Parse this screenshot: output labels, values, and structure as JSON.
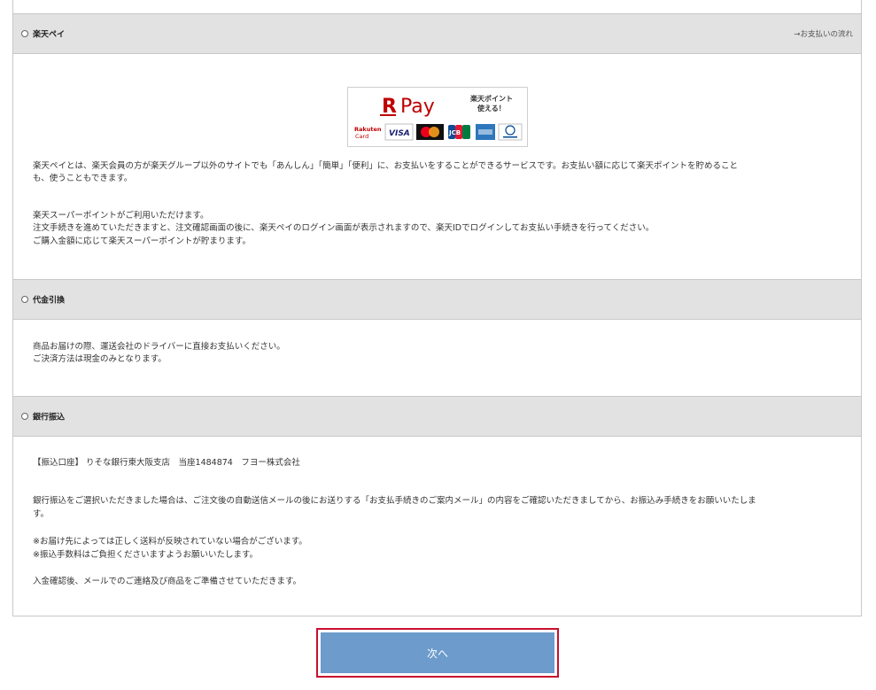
{
  "rakuten_pay": {
    "label": "楽天ペイ",
    "flow_link": "→お支払いの流れ",
    "logo": {
      "brand": "Pay",
      "tagline_line1": "楽天ポイント",
      "tagline_line2": "使える！",
      "card_brand_line1": "Rakuten",
      "card_brand_line2": "Card",
      "cards": [
        "VISA",
        "Mastercard",
        "JCB",
        "AMEX",
        "Diners Club"
      ],
      "visa_text": "VISA",
      "jcb_text": "JCB"
    },
    "desc_line1": "楽天ペイとは、楽天会員の方が楽天グループ以外のサイトでも「あんしん」「簡単」「便利」に、お支払いをすることができるサービスです。お支払い額に応じて楽天ポイントを貯めること",
    "desc_line2": "も、使うこともできます。",
    "point_line1": "楽天スーパーポイントがご利用いただけます。",
    "point_line2": "注文手続きを進めていただきますと、注文確認画面の後に、楽天ペイのログイン画面が表示されますので、楽天IDでログインしてお支払い手続きを行ってください。",
    "point_line3": "ご購入金額に応じて楽天スーパーポイントが貯まります。"
  },
  "cod": {
    "label": "代金引換",
    "line1": "商品お届けの際、運送会社のドライバーに直接お支払いください。",
    "line2": "ご決済方法は現金のみとなります。"
  },
  "bank": {
    "label": "銀行振込",
    "account": "【振込口座】 りそな銀行東大阪支店　当座1484874　フヨー株式会社",
    "desc_line1": "銀行振込をご選択いただきました場合は、ご注文後の自動送信メールの後にお送りする「お支払手続きのご案内メール」の内容をご確認いただきましてから、お振込み手続きをお願いいたしま",
    "desc_line2": "す。",
    "note1": "※お届け先によっては正しく送料が反映されていない場合がございます。",
    "note2": "※振込手数料はご負担くださいますようお願いいたします。",
    "confirm": "入金確認後、メールでのご連絡及び商品をご準備させていただきます。"
  },
  "next_button": {
    "label": "次へ"
  },
  "colors": {
    "header_bg": "#e2e2e2",
    "button_bg": "#6c9bcc",
    "highlight_border": "#c8102e",
    "rakuten_red": "#bf0000"
  }
}
